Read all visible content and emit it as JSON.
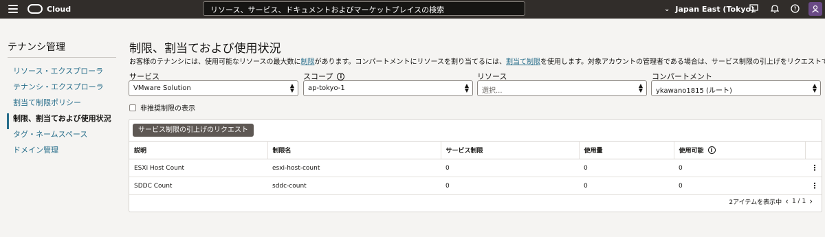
{
  "topbar": {
    "brand": "Cloud",
    "search_placeholder": "リソース、サービス、ドキュメントおよびマーケットプレイスの検索",
    "region": "Japan East (Tokyo)",
    "avatar_initial": "&"
  },
  "sidebar": {
    "title": "テナンシ管理",
    "items": [
      {
        "label": "リソース・エクスプローラ",
        "active": false
      },
      {
        "label": "テナンシ・エクスプローラ",
        "active": false
      },
      {
        "label": "割当て制限ポリシー",
        "active": false
      },
      {
        "label": "制限、割当ておよび使用状況",
        "active": true
      },
      {
        "label": "タグ・ネームスペース",
        "active": false
      },
      {
        "label": "ドメイン管理",
        "active": false
      }
    ]
  },
  "main": {
    "title": "制限、割当ておよび使用状況",
    "desc_part1": "お客様のテナンシには、使用可能なリソースの最大数に",
    "desc_link1": "制限",
    "desc_part2": "があります。コンパートメントにリソースを割り当てるには、",
    "desc_link2": "割当て制限",
    "desc_part3": "を使用します。対象アカウントの管理者である場合は、サービス制限の引上げをリクエストできます。",
    "filters": {
      "service_label": "サービス",
      "service_value": "VMware Solution",
      "scope_label": "スコープ",
      "scope_value": "ap-tokyo-1",
      "resource_label": "リソース",
      "resource_placeholder": "選択...",
      "compartment_label": "コンパートメント",
      "compartment_value": "ykawano1815 (ルート)"
    },
    "deprecated_label": "非推奨制限の表示",
    "request_button": "サービス制限の引上げのリクエスト",
    "table": {
      "headers": [
        "説明",
        "制限名",
        "サービス制限",
        "使用量",
        "使用可能"
      ],
      "rows": [
        [
          "ESXi Host Count",
          "esxi-host-count",
          "0",
          "0",
          "0"
        ],
        [
          "SDDC Count",
          "sddc-count",
          "0",
          "0",
          "0"
        ]
      ]
    },
    "pager": {
      "count_text": "2アイテムを表示中",
      "page_text": "1 / 1"
    }
  },
  "colors": {
    "topbar_bg": "#312d2a",
    "link": "#286e8b",
    "button_bg": "#5e5854"
  }
}
